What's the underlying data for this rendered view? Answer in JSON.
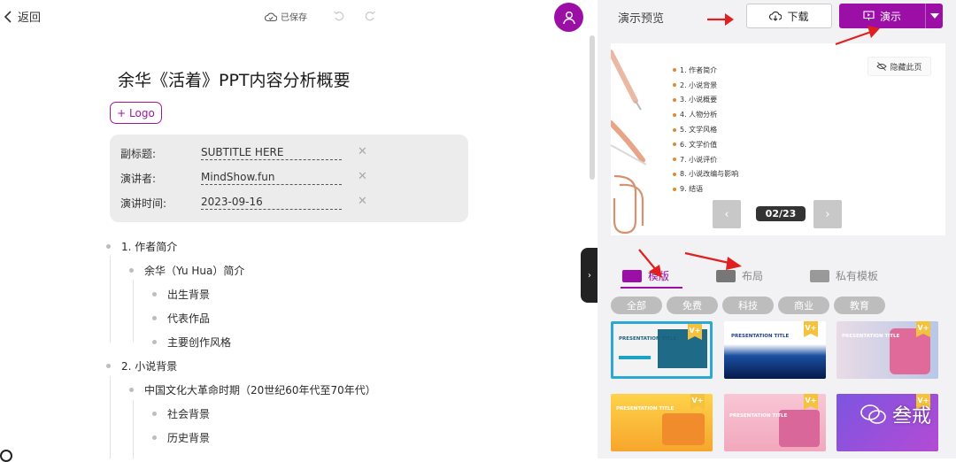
{
  "topbar": {
    "back_label": "返回",
    "saved_label": "已保存"
  },
  "doc": {
    "title": "余华《活着》PPT内容分析概要",
    "logo_button": "+ Logo",
    "meta": [
      {
        "label": "副标题:",
        "value": "SUBTITLE HERE"
      },
      {
        "label": "演讲者:",
        "value": "MindShow.fun"
      },
      {
        "label": "演讲时间:",
        "value": "2023-09-16"
      }
    ]
  },
  "outline": [
    {
      "text": "1. 作者简介",
      "level": 0
    },
    {
      "text": "余华（Yu Hua）简介",
      "level": 1
    },
    {
      "text": "出生背景",
      "level": 2
    },
    {
      "text": "代表作品",
      "level": 2
    },
    {
      "text": "主要创作风格",
      "level": 2
    },
    {
      "text": "2. 小说背景",
      "level": 0
    },
    {
      "text": "中国文化大革命时期（20世纪60年代至70年代）",
      "level": 1
    },
    {
      "text": "社会背景",
      "level": 2
    },
    {
      "text": "历史背景",
      "level": 2
    }
  ],
  "panel": {
    "title": "演示预览",
    "download_label": "下载",
    "present_label": "演示",
    "hide_page_label": "隐藏此页",
    "pager": "02/23",
    "toc": [
      "1. 作者简介",
      "2. 小说背景",
      "3. 小说概要",
      "4. 人物分析",
      "5. 文学风格",
      "6. 文学价值",
      "7. 小说评价",
      "8. 小说改编与影响",
      "9. 结语"
    ],
    "tabs": [
      {
        "label": "模版",
        "active": true
      },
      {
        "label": "布局",
        "active": false
      },
      {
        "label": "私有模板",
        "active": false
      }
    ],
    "chips": [
      "全部",
      "免费",
      "科技",
      "商业",
      "教育"
    ],
    "thumb_titles": [
      "PRESENTATION TITLE",
      "PRESENTATION TITLE",
      "PRESENTATION TITLE",
      "PRESENTATION TITLE",
      "PRESENTATION TITLE"
    ],
    "badge": "V+",
    "watermark": "叁戒"
  },
  "colors": {
    "accent": "#9b0fa6",
    "arrow": "#e02020"
  }
}
